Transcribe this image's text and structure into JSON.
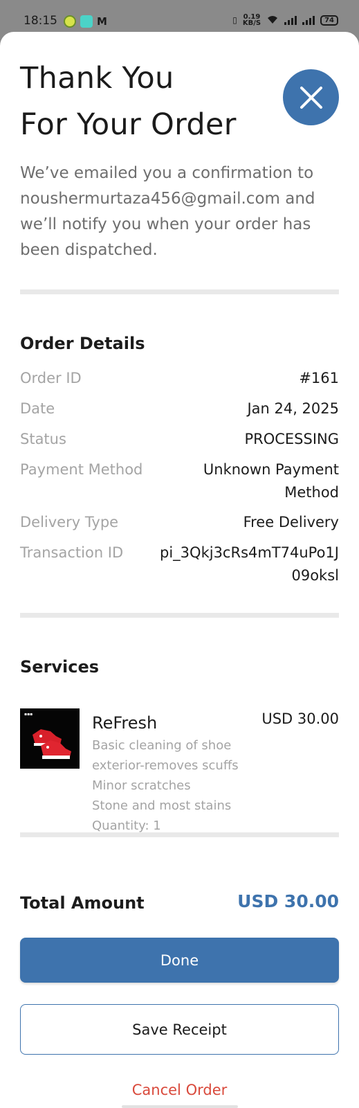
{
  "status_bar": {
    "time": "18:15",
    "speed_top": "0.19",
    "speed_unit": "KB/S",
    "battery": "74",
    "mail_glyph": "M"
  },
  "header": {
    "title_line1": "Thank You",
    "title_line2": "For Your Order",
    "close_icon": "close-icon"
  },
  "intro": {
    "text": "We’ve emailed you a confirmation to noushermurtaza456@gmail.com and we’ll notify you when your order has been dispatched."
  },
  "order_details": {
    "title": "Order Details",
    "rows": [
      {
        "label": "Order ID",
        "value": "#161"
      },
      {
        "label": "Date",
        "value": "Jan 24, 2025"
      },
      {
        "label": "Status",
        "value": "PROCESSING"
      },
      {
        "label": "Payment Method",
        "value_line1": "Unknown Payment",
        "value_line2": "Method"
      },
      {
        "label": "Delivery Type",
        "value": "Free Delivery"
      },
      {
        "label": "Transaction ID",
        "value_line1": "pi_3Qkj3cRs4mT74uPo1J",
        "value_line2": "09oksl"
      }
    ]
  },
  "services": {
    "title": "Services",
    "items": [
      {
        "name": "ReFresh",
        "price": "USD 30.00",
        "desc_lines": [
          "Basic cleaning of shoe",
          "exterior-removes scuffs",
          "Minor scratches",
          "Stone and most stains"
        ],
        "quantity": "Quantity: 1"
      }
    ]
  },
  "total": {
    "label": "Total Amount",
    "value": "USD 30.00"
  },
  "actions": {
    "done": "Done",
    "save_receipt": "Save Receipt",
    "cancel_order": "Cancel Order"
  },
  "colors": {
    "accent": "#3e73ad",
    "danger": "#d9493b",
    "muted_text": "#a4a4a4"
  }
}
